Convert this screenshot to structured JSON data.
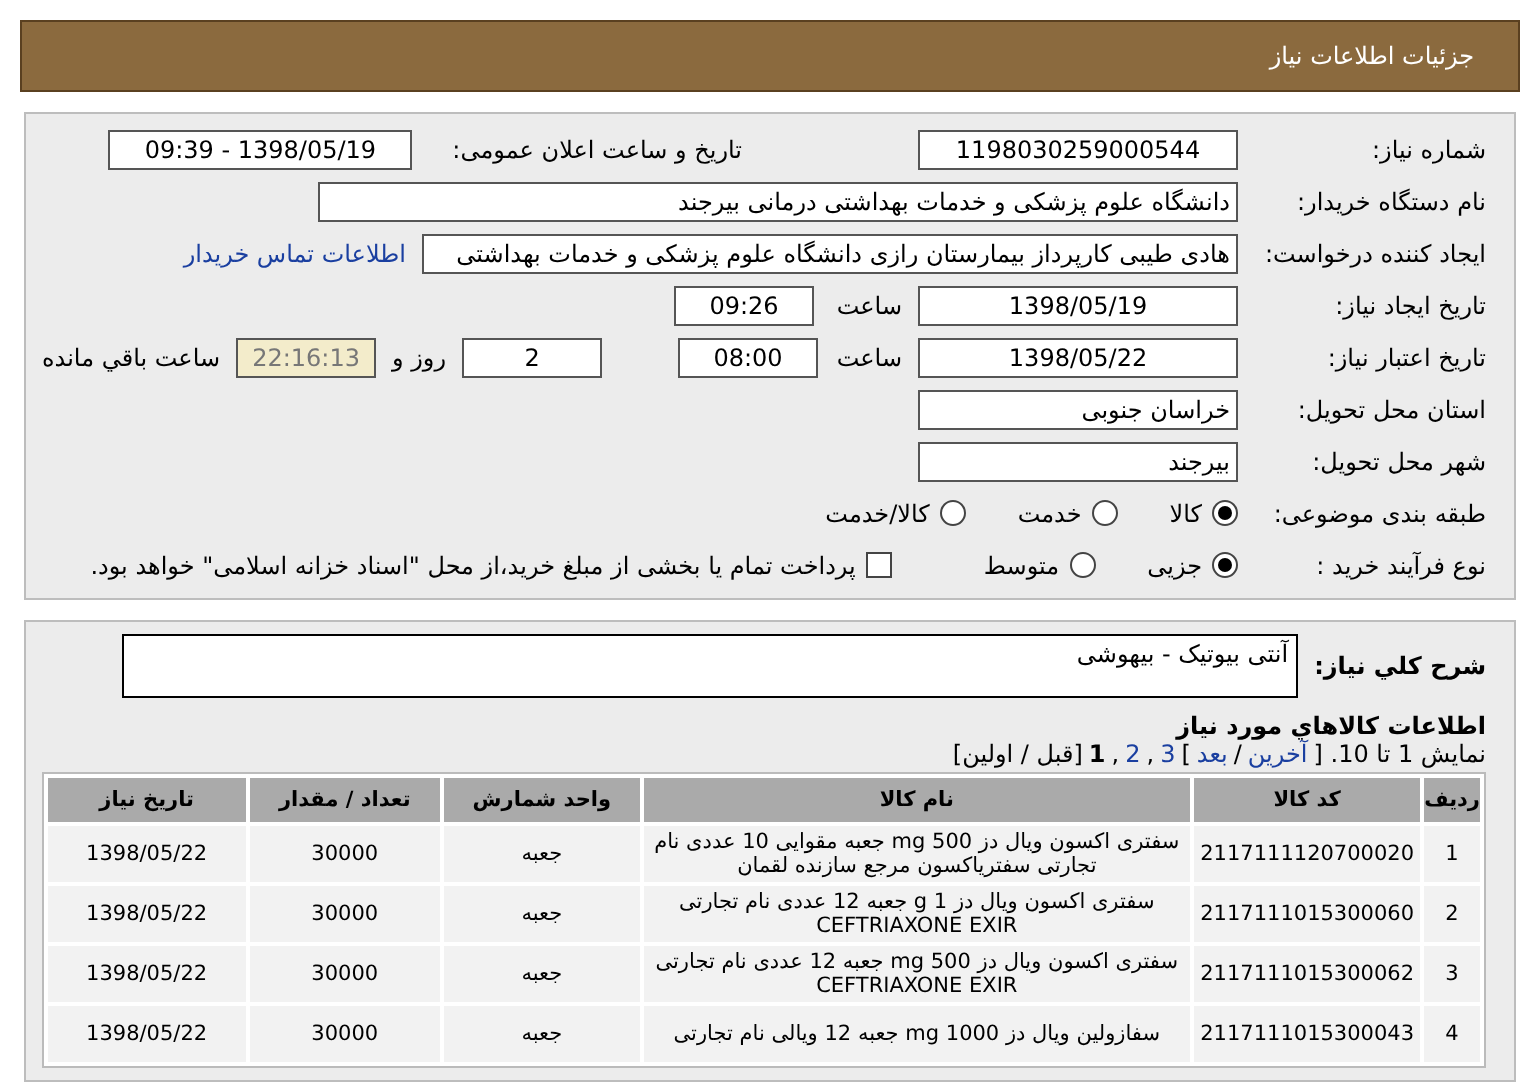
{
  "header": {
    "title": "جزئیات اطلاعات نیاز"
  },
  "details": {
    "need_number": {
      "label": "شماره نیاز:",
      "value": "1198030259000544"
    },
    "announce": {
      "label": "تاریخ و ساعت اعلان عمومی:",
      "value": "1398/05/19 - 09:39"
    },
    "buyer": {
      "label": "نام دستگاه خریدار:",
      "value": "دانشگاه علوم پزشکی و خدمات بهداشتی درمانی بیرجند"
    },
    "creator": {
      "label": "ایجاد کننده درخواست:",
      "value": "هادی طیبی کارپرداز بیمارستان رازی دانشگاه علوم پزشکی و خدمات بهداشتی",
      "link": "اطلاعات تماس خریدار"
    },
    "created": {
      "label": "تاریخ ایجاد نیاز:",
      "date": "1398/05/19",
      "time_label": "ساعت",
      "time": "09:26"
    },
    "valid": {
      "label": "تاریخ اعتبار نیاز:",
      "date": "1398/05/22",
      "time_label": "ساعت",
      "time": "08:00",
      "days": "2",
      "days_label": "روز و",
      "remaining": "22:16:13",
      "remaining_label": "ساعت باقي مانده"
    },
    "province": {
      "label": "استان محل تحویل:",
      "value": "خراسان جنوبی"
    },
    "city": {
      "label": "شهر محل تحویل:",
      "value": "بیرجند"
    },
    "category": {
      "label": "طبقه بندی موضوعی:",
      "options": [
        {
          "label": "کالا",
          "selected": true
        },
        {
          "label": "خدمت",
          "selected": false
        },
        {
          "label": "کالا/خدمت",
          "selected": false
        }
      ]
    },
    "purchase": {
      "label": "نوع فرآیند خرید :",
      "options": [
        {
          "label": "جزیی",
          "selected": true
        },
        {
          "label": "متوسط",
          "selected": false
        }
      ],
      "payment": {
        "label": "پرداخت تمام یا بخشی از مبلغ خرید،از محل \"اسناد خزانه اسلامی\" خواهد بود.",
        "checked": false
      }
    }
  },
  "summary": {
    "label": "شرح کلي نياز:",
    "value": "آنتی بیوتیک - بیهوشی"
  },
  "goods": {
    "title": "اطلاعات کالاهاي مورد نياز",
    "pagination": [
      {
        "kind": "text",
        "text": "نمایش 1 تا 10. ["
      },
      {
        "kind": "link",
        "text": "آخرین"
      },
      {
        "kind": "text",
        "text": "/"
      },
      {
        "kind": "link",
        "text": "بعد"
      },
      {
        "kind": "text",
        "text": "]"
      },
      {
        "kind": "link",
        "text": "3"
      },
      {
        "kind": "text",
        "text": ","
      },
      {
        "kind": "link",
        "text": "2"
      },
      {
        "kind": "text",
        "text": ","
      },
      {
        "kind": "current",
        "text": "1"
      },
      {
        "kind": "text",
        "text": "[قبل / اولین]"
      }
    ],
    "columns": [
      "ردیف",
      "کد کالا",
      "نام کالا",
      "واحد شمارش",
      "تعداد / مقدار",
      "تاریخ نیاز"
    ],
    "rows": [
      [
        "1",
        "2117111120700020",
        "سفتری اکسون ویال دز 500 mg جعبه مقوایی 10 عددی نام تجارتی سفتریاکسون مرجع سازنده لقمان",
        "جعبه",
        "30000",
        "1398/05/22"
      ],
      [
        "2",
        "2117111015300060",
        "سفتری اکسون ویال دز 1 g جعبه 12 عددی نام تجارتی CEFTRIAXONE EXIR",
        "جعبه",
        "30000",
        "1398/05/22"
      ],
      [
        "3",
        "2117111015300062",
        "سفتری اکسون ویال دز 500 mg جعبه 12 عددی نام تجارتی CEFTRIAXONE EXIR",
        "جعبه",
        "30000",
        "1398/05/22"
      ],
      [
        "4",
        "2117111015300043",
        "سفازولین ویال دز 1000 mg جعبه 12 ویالی نام تجارتی",
        "جعبه",
        "30000",
        "1398/05/22"
      ]
    ]
  }
}
